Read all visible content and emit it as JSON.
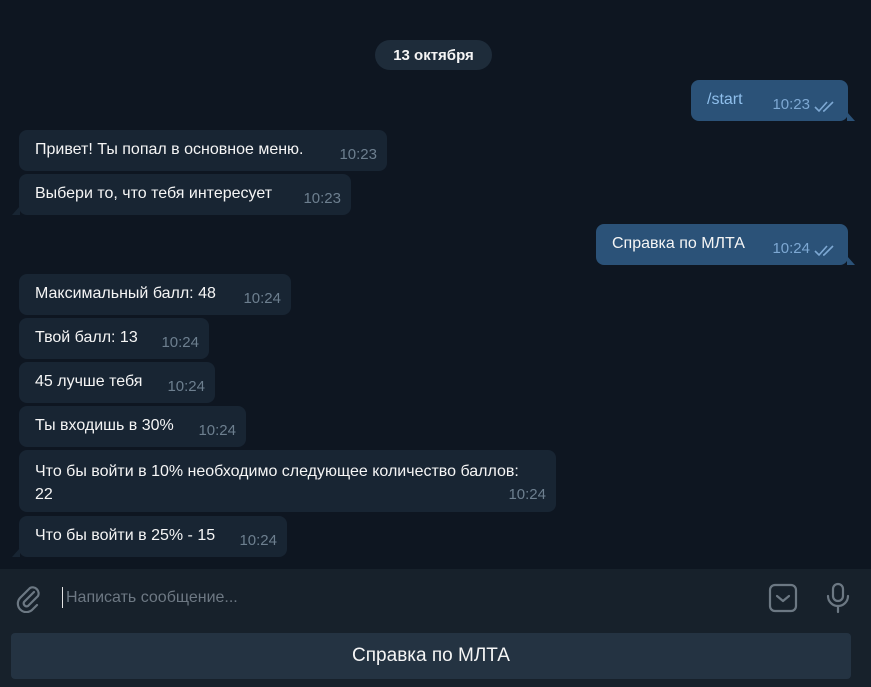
{
  "date_separator": "13 октября",
  "messages": [
    {
      "text": "/start",
      "time": "10:23",
      "direction": "out"
    },
    {
      "text": "Привет! Ты попал в основное меню.",
      "time": "10:23",
      "direction": "in"
    },
    {
      "text": "Выбери то, что тебя интересует",
      "time": "10:23",
      "direction": "in"
    },
    {
      "text": "Справка по МЛТА",
      "time": "10:24",
      "direction": "out"
    },
    {
      "text": "Максимальный балл: 48",
      "time": "10:24",
      "direction": "in"
    },
    {
      "text": "Твой балл: 13",
      "time": "10:24",
      "direction": "in"
    },
    {
      "text": "45 лучше тебя",
      "time": "10:24",
      "direction": "in"
    },
    {
      "text": "Ты входишь в 30%",
      "time": "10:24",
      "direction": "in"
    },
    {
      "text_line1": "Что бы войти в 10% необходимо следующее количество баллов:",
      "text_line2": "22",
      "time": "10:24",
      "direction": "in"
    },
    {
      "text": "Что бы войти в 25% - 15",
      "time": "10:24",
      "direction": "in"
    }
  ],
  "composer": {
    "placeholder": "Написать сообщение...",
    "attach_icon": "paperclip-icon",
    "emoji_icon": "sticker-icon",
    "mic_icon": "microphone-icon"
  },
  "reply_keyboard": {
    "button_label": "Справка по МЛТА"
  },
  "colors": {
    "background": "#0e1621",
    "incoming_bubble": "#182533",
    "outgoing_bubble": "#2b5278",
    "panel": "#17212b",
    "read_checks": "#7da8d3"
  }
}
